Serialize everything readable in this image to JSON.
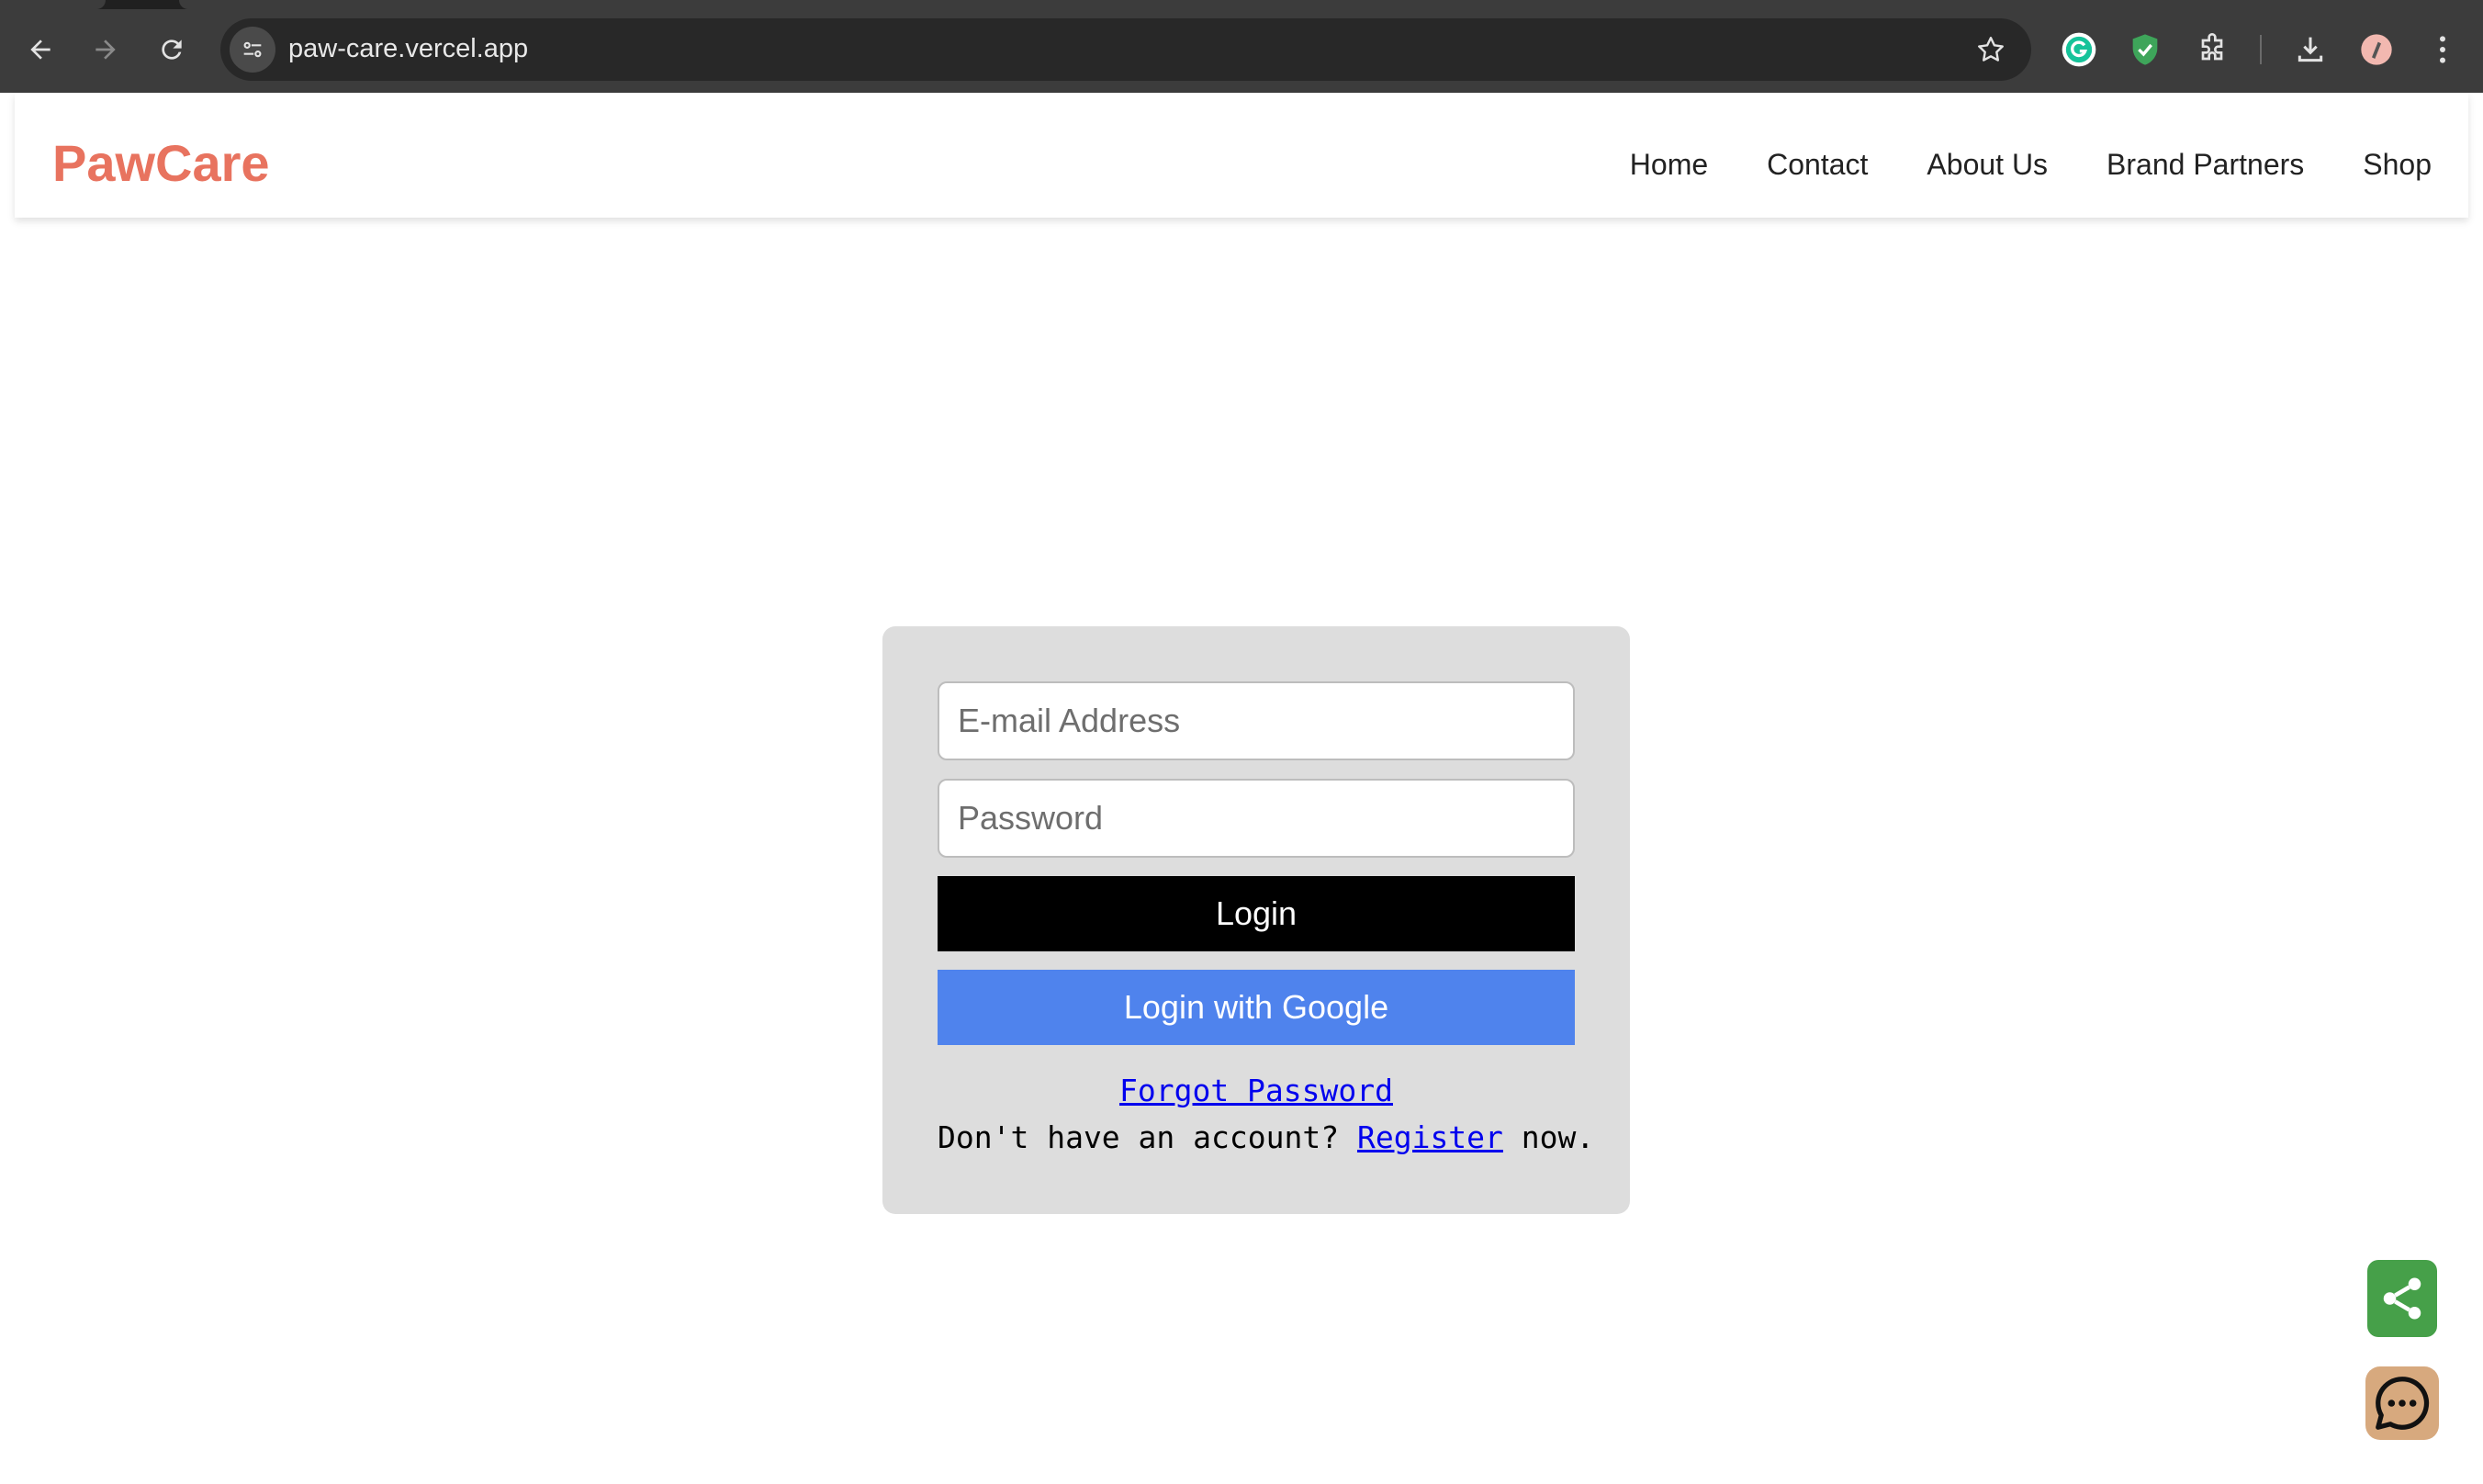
{
  "browser": {
    "url": "paw-care.vercel.app",
    "icons": {
      "back": "back-arrow-icon",
      "forward": "forward-arrow-icon",
      "reload": "reload-icon",
      "site_info": "tune-icon",
      "bookmark": "star-icon",
      "extensions": [
        "grammarly-icon",
        "shield-icon",
        "puzzle-icon"
      ],
      "download": "download-icon",
      "profile": "avatar",
      "menu": "kebab-menu-icon"
    }
  },
  "site": {
    "logo": "PawCare",
    "nav": [
      "Home",
      "Contact",
      "About Us",
      "Brand Partners",
      "Shop"
    ],
    "colors": {
      "logo": "#e8735f",
      "login_button": "#000000",
      "google_button": "#4f83ed",
      "card_bg": "#dddddd",
      "link": "#0000ee",
      "share_fab": "#46a049",
      "chat_fab": "#d7a97e"
    }
  },
  "login": {
    "email_placeholder": "E-mail Address",
    "password_placeholder": "Password",
    "login_label": "Login",
    "google_label": "Login with Google",
    "forgot_label": "Forgot Password",
    "register_prefix": "Don't have an account? ",
    "register_link": "Register",
    "register_suffix": " now."
  },
  "floating": {
    "share_icon": "share-icon",
    "chat_icon": "chat-icon"
  }
}
